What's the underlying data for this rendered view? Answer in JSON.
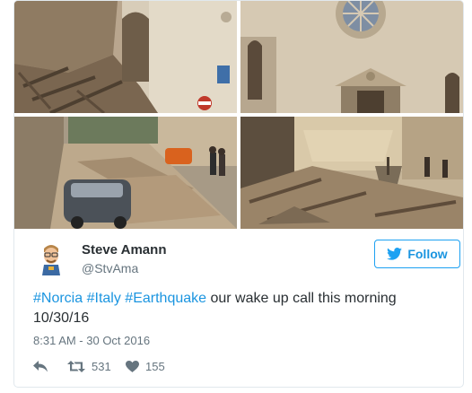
{
  "tweet": {
    "author_name": "Steve Amann",
    "author_handle": "@StvAma",
    "follow_label": "Follow",
    "text_segments": {
      "tag1": "#Norcia",
      "sep1": " ",
      "tag2": "#Italy",
      "sep2": " ",
      "tag3": "#Earthquake",
      "rest": " our wake up call this morning 10/30/16"
    },
    "timestamp": "8:31 AM - 30 Oct 2016",
    "retweet_count": "531",
    "like_count": "155"
  },
  "icons": {
    "follow": "twitter-bird-icon",
    "reply": "reply-icon",
    "retweet": "retweet-icon",
    "like": "heart-icon"
  },
  "colors": {
    "link": "#1b95e0",
    "follow_border": "#1da1f2",
    "text": "#292f33",
    "muted": "#66757f",
    "border": "#e1e8ed"
  },
  "media": {
    "photos": [
      "photo-rubble-church-facade",
      "photo-church-rose-window",
      "photo-street-debris-car",
      "photo-collapsed-piazza"
    ]
  }
}
